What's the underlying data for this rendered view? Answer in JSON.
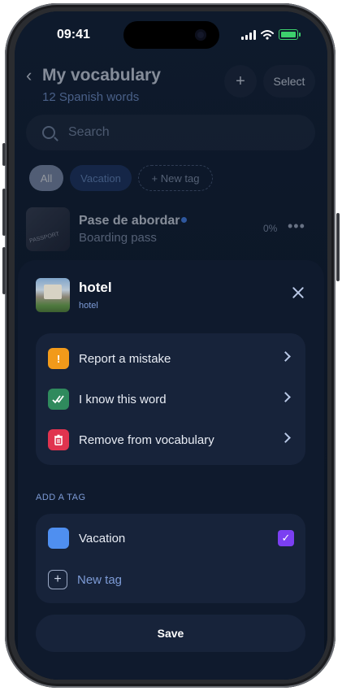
{
  "status_bar": {
    "time": "09:41"
  },
  "header": {
    "back_icon": "chevron-left-icon",
    "title": "My vocabulary",
    "subtitle": "12 Spanish words",
    "add_label": "+",
    "select_label": "Select"
  },
  "search": {
    "placeholder": "Search"
  },
  "filters": {
    "all": "All",
    "vacation": "Vacation",
    "new_tag": "+ New tag"
  },
  "word_row": {
    "word": "Pase de abordar",
    "translation": "Boarding pass",
    "progress": "0%",
    "more": "•••"
  },
  "sheet": {
    "word": "hotel",
    "translation": "hotel",
    "actions": [
      {
        "label": "Report a mistake",
        "icon": "exclamation-icon",
        "color": "#f29a1a"
      },
      {
        "label": "I know this word",
        "icon": "double-check-icon",
        "color": "#2f8a5d"
      },
      {
        "label": "Remove from vocabulary",
        "icon": "trash-icon",
        "color": "#e0334f"
      }
    ],
    "add_tag_label": "ADD A TAG",
    "tags": [
      {
        "label": "Vacation",
        "checked": true,
        "color": "#4f8ff0"
      }
    ],
    "new_tag_label": "New tag",
    "save_label": "Save"
  },
  "colors": {
    "background": "#0b1424",
    "sheet": "#0f1a2d",
    "card": "#17233a",
    "accent": "#7d9bd6",
    "check": "#7b3ff2"
  }
}
